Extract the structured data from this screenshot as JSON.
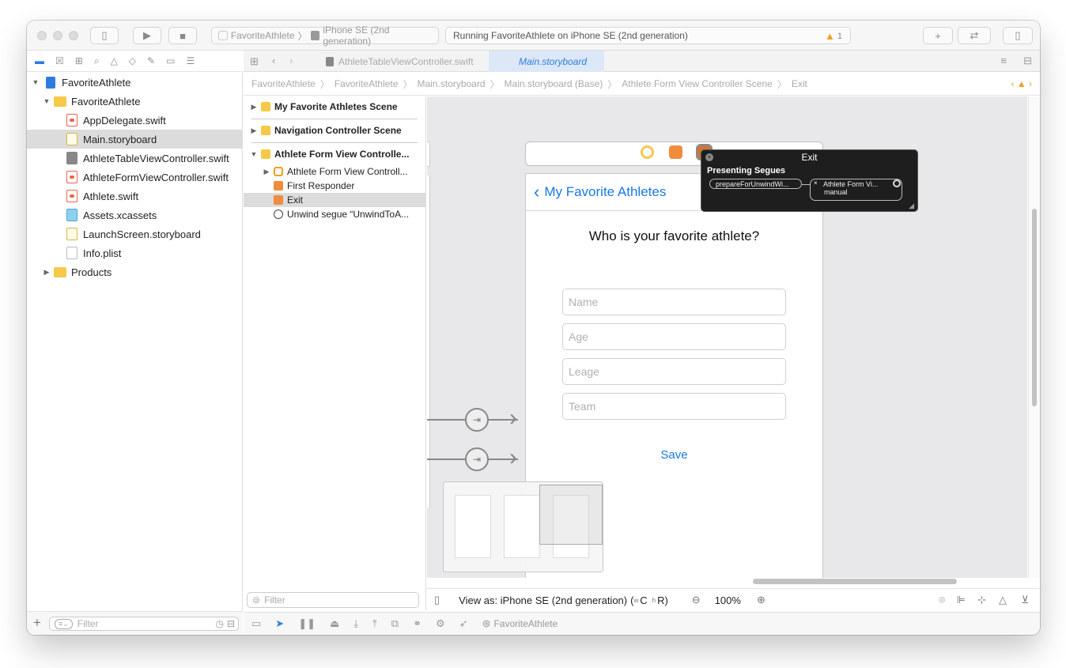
{
  "toolbar": {
    "scheme_target": "FavoriteAthlete",
    "scheme_device": "iPhone SE (2nd generation)",
    "status_text": "Running FavoriteAthlete on iPhone SE (2nd generation)",
    "warning_count": "1"
  },
  "navigator": {
    "items": [
      {
        "label": "FavoriteAthlete"
      },
      {
        "label": "FavoriteAthlete"
      },
      {
        "label": "AppDelegate.swift"
      },
      {
        "label": "Main.storyboard"
      },
      {
        "label": "AthleteTableViewController.swift"
      },
      {
        "label": "AthleteFormViewController.swift"
      },
      {
        "label": "Athlete.swift"
      },
      {
        "label": "Assets.xcassets"
      },
      {
        "label": "LaunchScreen.storyboard"
      },
      {
        "label": "Info.plist"
      },
      {
        "label": "Products"
      }
    ],
    "filter_placeholder": "Filter"
  },
  "tabs": [
    {
      "label": "AthleteTableViewController.swift"
    },
    {
      "label": "Main.storyboard"
    }
  ],
  "jumpbar": [
    "FavoriteAthlete",
    "FavoriteAthlete",
    "Main.storyboard",
    "Main.storyboard (Base)",
    "Athlete Form View Controller Scene",
    "Exit"
  ],
  "outline": {
    "items": [
      {
        "label": "My Favorite Athletes Scene"
      },
      {
        "label": "Navigation Controller Scene"
      },
      {
        "label": "Athlete Form View Controlle..."
      },
      {
        "label": "Athlete Form View Controll..."
      },
      {
        "label": "First Responder"
      },
      {
        "label": "Exit"
      },
      {
        "label": "Unwind segue “UnwindToA..."
      }
    ],
    "filter_placeholder": "Filter"
  },
  "canvas": {
    "nav_back_title": "My Favorite Athletes",
    "question": "Who is your favorite athlete?",
    "fields": [
      {
        "placeholder": "Name"
      },
      {
        "placeholder": "Age"
      },
      {
        "placeholder": "Leage"
      },
      {
        "placeholder": "Team"
      }
    ],
    "save_label": "Save"
  },
  "popover": {
    "title": "Exit",
    "heading": "Presenting Segues",
    "segue_action": "prepareForUnwindWi...",
    "segue_source": "Athlete Form Vi...",
    "segue_kind": "manual"
  },
  "editor_bottom": {
    "view_as": "View as: iPhone SE (2nd generation)",
    "size_class_w": "w",
    "size_class_c": "C",
    "size_class_h": "h",
    "size_class_r": "R)",
    "size_class_open": "(",
    "zoom": "100%"
  },
  "debug": {
    "target": "FavoriteAthlete"
  },
  "colors": {
    "accent": "#2f7ce0",
    "ios_tint": "#1a78e6",
    "warning": "#f0a020"
  }
}
